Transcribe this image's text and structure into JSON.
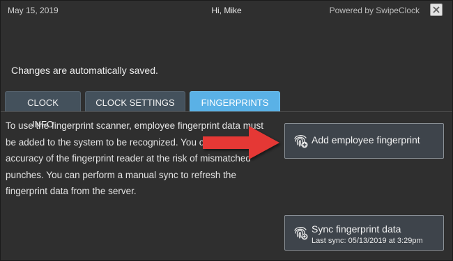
{
  "header": {
    "date": "May 15, 2019",
    "greeting": "Hi, Mike",
    "powered_by": "Powered by SwipeClock"
  },
  "notice": "Changes are automatically saved.",
  "tabs": [
    {
      "label": "CLOCK INFO",
      "active": false
    },
    {
      "label": "CLOCK SETTINGS",
      "active": false
    },
    {
      "label": "FINGERPRINTS",
      "active": true
    }
  ],
  "fingerprints": {
    "description": "To use the fingerprint scanner, employee fingerprint data must be added to the system to be recognized. You can adjust the accuracy of the fingerprint reader at the risk of mismatched punches. You can perform a manual sync to refresh the fingerprint data from the server.",
    "add_button_label": "Add employee fingerprint",
    "sync_button_label": "Sync fingerprint data",
    "last_sync": "Last sync: 05/13/2019 at 3:29pm"
  },
  "colors": {
    "background": "#2f2f2f",
    "tab_inactive": "#44515c",
    "tab_active": "#5ab1e6",
    "button_bg": "#3e444b",
    "annotation_arrow": "#e53935"
  },
  "icons": {
    "close": "close-icon",
    "fingerprint_add": "fingerprint-add-icon",
    "fingerprint_sync": "fingerprint-sync-icon",
    "annotation": "red-arrow"
  }
}
